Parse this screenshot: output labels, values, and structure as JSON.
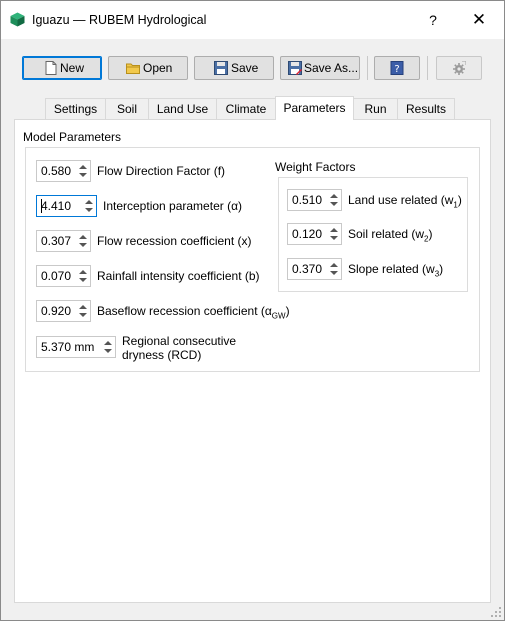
{
  "window": {
    "title": "Iguazu — RUBEM Hydrological",
    "help_label": "?",
    "close_label": "✕"
  },
  "toolbar": {
    "new_label": "New",
    "open_label": "Open",
    "save_label": "Save",
    "save_as_label": "Save As...",
    "icons": [
      "new-file-icon",
      "open-folder-icon",
      "save-disk-icon",
      "save-as-disk-icon",
      "help-book-icon",
      "run-gear-icon"
    ]
  },
  "tabs": [
    {
      "label": "Settings"
    },
    {
      "label": "Soil"
    },
    {
      "label": "Land Use"
    },
    {
      "label": "Climate"
    },
    {
      "label": "Parameters",
      "active": true
    },
    {
      "label": "Run"
    },
    {
      "label": "Results"
    }
  ],
  "model_params": {
    "title": "Model Parameters",
    "items": [
      {
        "value": "0.580",
        "label": "Flow Direction Factor (f)"
      },
      {
        "value": "4.410",
        "label": "Interception parameter (α)"
      },
      {
        "value": "0.307",
        "label": "Flow recession coefficient (x)"
      },
      {
        "value": "0.070",
        "label": "Rainfall intensity coefficient (b)"
      },
      {
        "value": "0.920",
        "label": "Baseflow recession coefficient (α",
        "sub": "GW",
        "suffix": ")"
      },
      {
        "value": "5.370 mm",
        "label": "Regional consecutive",
        "label2": "dryness (RCD)"
      }
    ]
  },
  "weight_factors": {
    "title": "Weight Factors",
    "items": [
      {
        "value": "0.510",
        "label": "Land use related (w",
        "sub": "1",
        "suffix": ")"
      },
      {
        "value": "0.120",
        "label": "Soil related (w",
        "sub": "2",
        "suffix": ")"
      },
      {
        "value": "0.370",
        "label": "Slope related (w",
        "sub": "3",
        "suffix": ")"
      }
    ]
  },
  "colors": {
    "accent": "#0078d7",
    "window_bg": "#f0f0f0",
    "panel_bg": "#ffffff",
    "app_icon": "#1e8e5a"
  }
}
